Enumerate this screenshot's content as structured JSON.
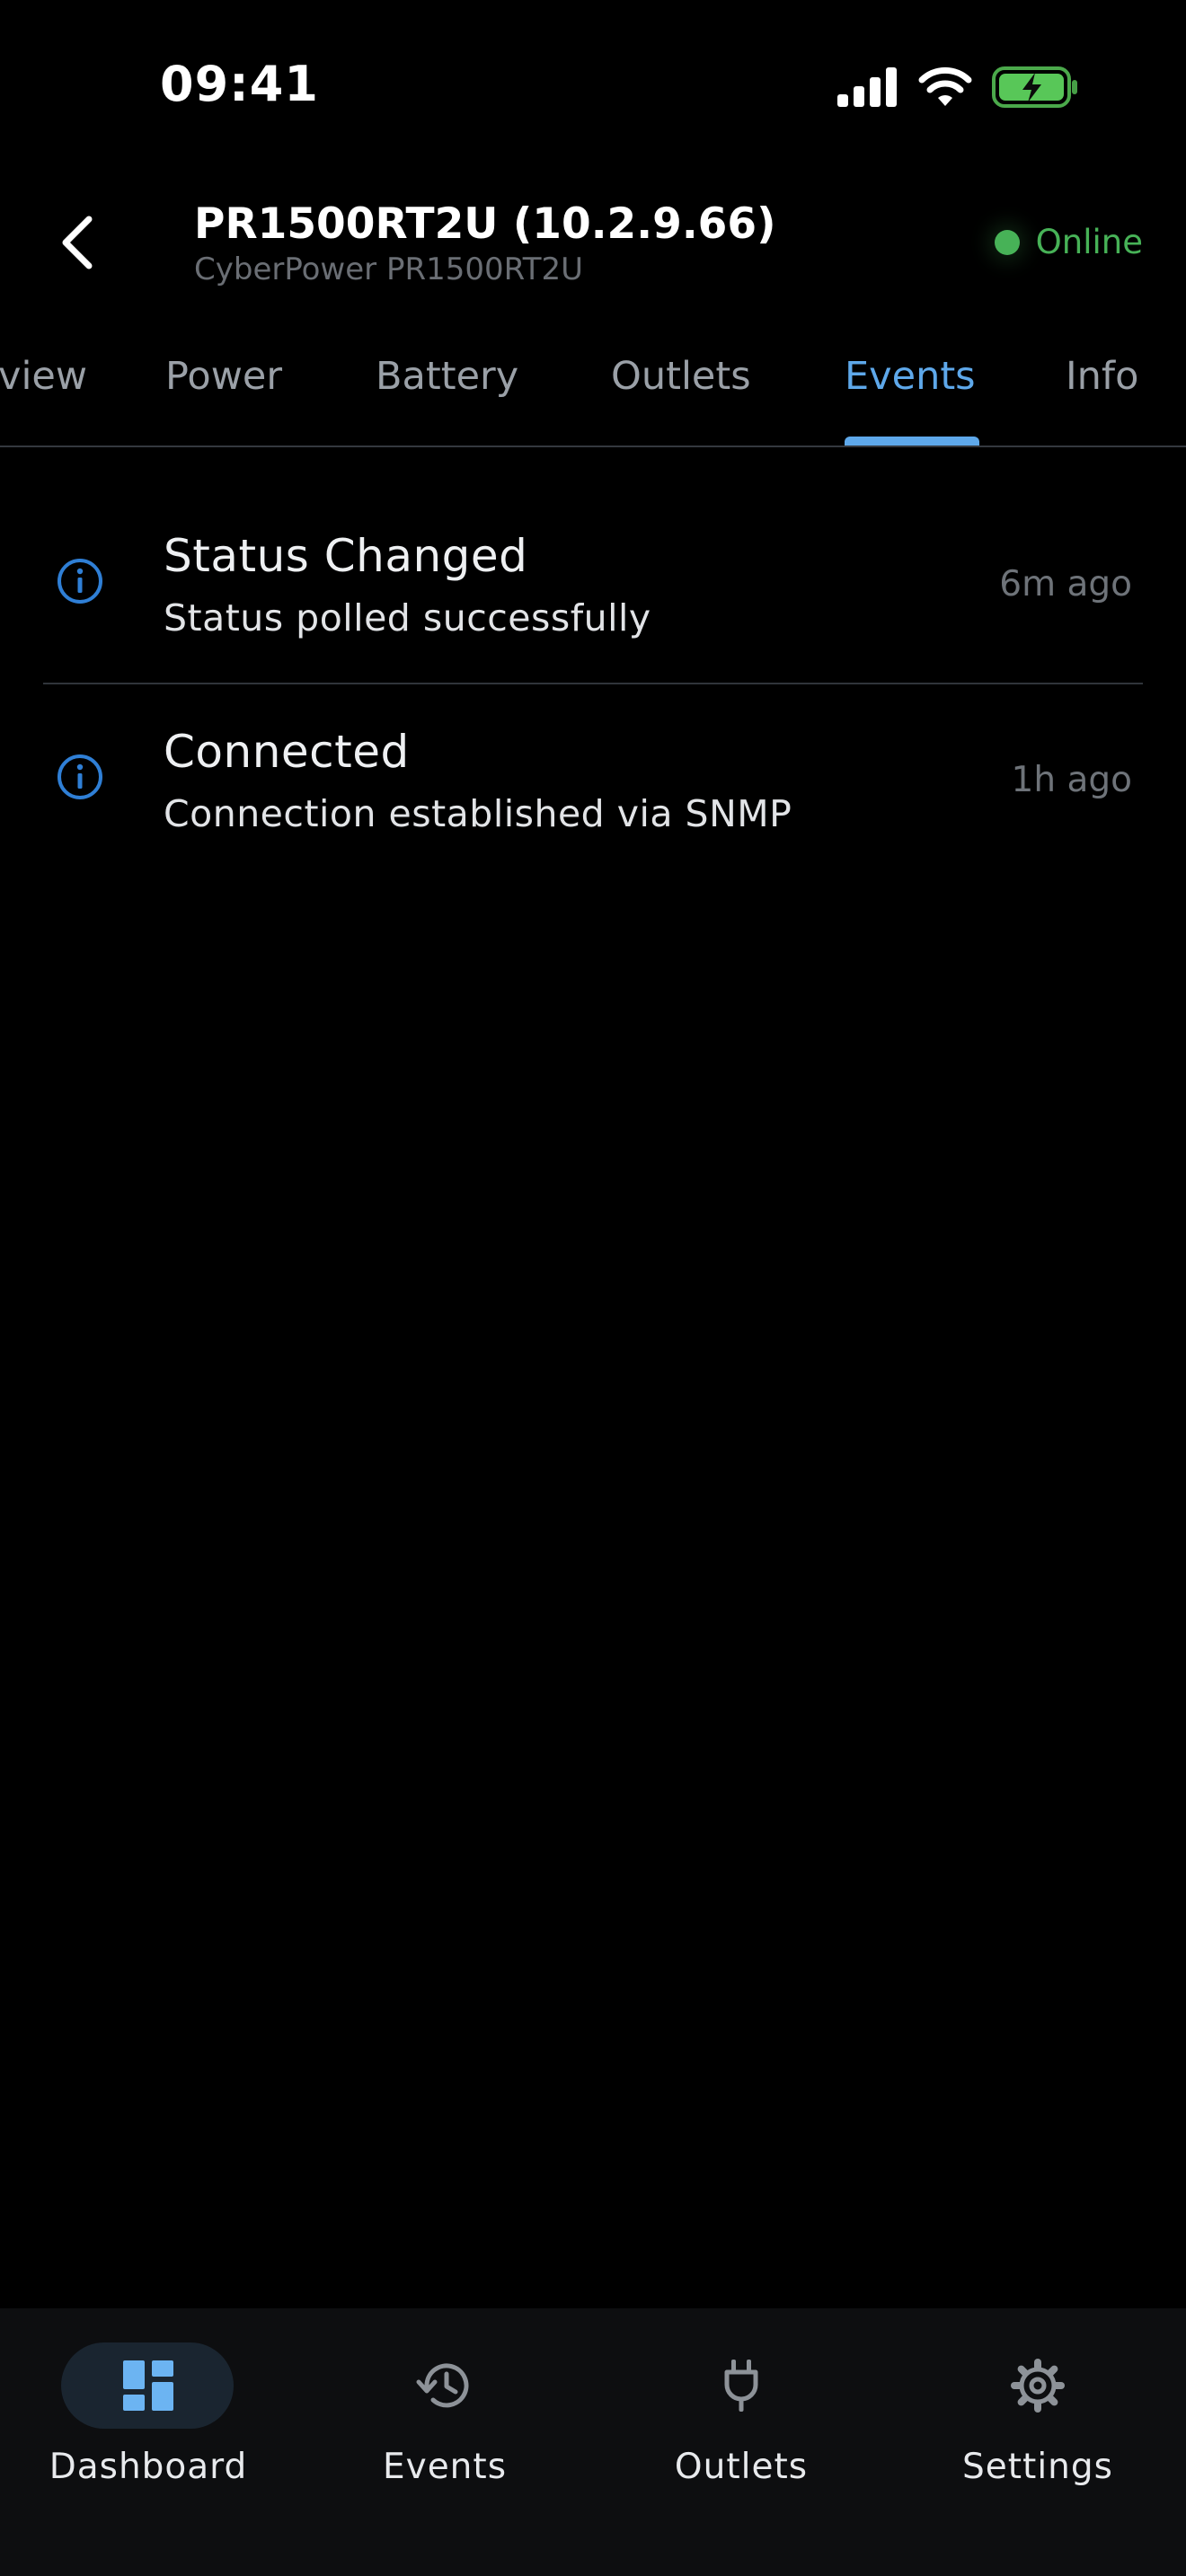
{
  "status_bar": {
    "time": "09:41"
  },
  "header": {
    "title": "PR1500RT2U (10.2.9.66)",
    "subtitle": "CyberPower PR1500RT2U",
    "status": "Online",
    "status_color": "#47b257"
  },
  "tabs": [
    {
      "label": "Overview",
      "visible_label": "view",
      "active": false
    },
    {
      "label": "Power",
      "active": false
    },
    {
      "label": "Battery",
      "active": false
    },
    {
      "label": "Outlets",
      "active": false
    },
    {
      "label": "Events",
      "active": true
    },
    {
      "label": "Info",
      "active": false
    }
  ],
  "events": [
    {
      "icon": "info-icon",
      "title": "Status Changed",
      "description": "Status polled successfully",
      "time": "6m ago"
    },
    {
      "icon": "info-icon",
      "title": "Connected",
      "description": "Connection established via SNMP",
      "time": "1h ago"
    }
  ],
  "bottom_nav": [
    {
      "label": "Dashboard",
      "icon": "dashboard-icon",
      "active": true
    },
    {
      "label": "Events",
      "icon": "history-icon",
      "active": false
    },
    {
      "label": "Outlets",
      "icon": "plug-icon",
      "active": false
    },
    {
      "label": "Settings",
      "icon": "gear-icon",
      "active": false
    }
  ],
  "colors": {
    "accent": "#5ea8ea",
    "info_icon": "#2f7fd6",
    "background": "#000000"
  }
}
